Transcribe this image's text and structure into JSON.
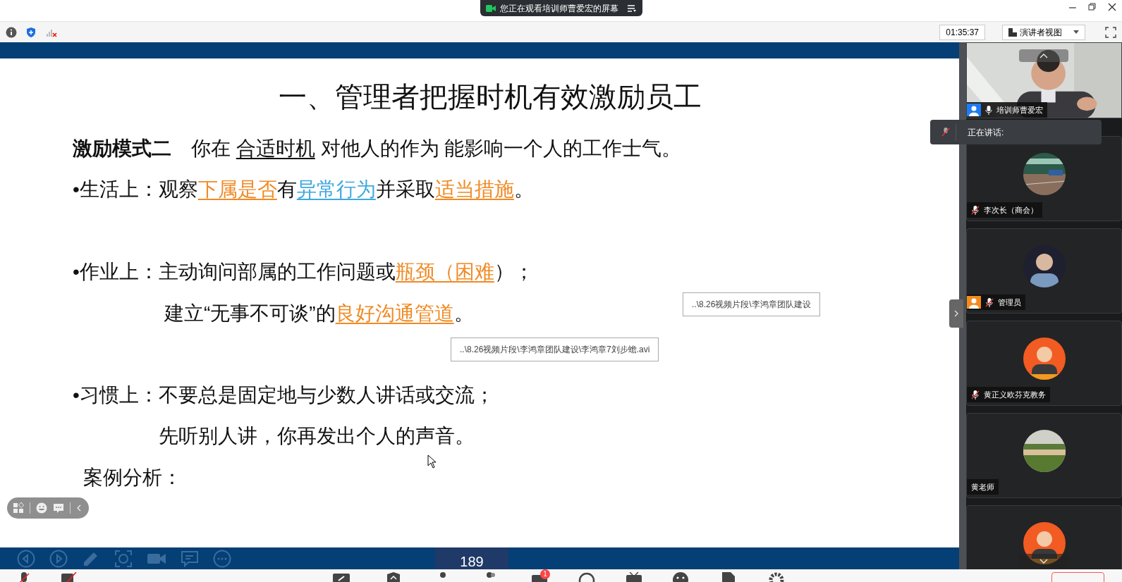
{
  "banner": {
    "text": "您正在观看培训师曹爱宏的屏幕"
  },
  "toolbar": {
    "time": "01:35:37",
    "view_button": "演讲者视图"
  },
  "slide": {
    "title": "一、管理者把握时机有效激励员工",
    "lines": [
      {
        "segments": [
          {
            "kind": "bold",
            "text": "激励模式二"
          },
          {
            "kind": "plain",
            "text": "　你在 "
          },
          {
            "kind": "underline",
            "text": "合适时机"
          },
          {
            "kind": "plain",
            "text": " 对他人的作为 能影响一个人的工作士气。"
          }
        ]
      },
      {
        "segments": [
          {
            "kind": "plain",
            "text": "•生活上：观察"
          },
          {
            "kind": "orange",
            "text": "下属是否"
          },
          {
            "kind": "plain",
            "text": "有"
          },
          {
            "kind": "blue",
            "text": "异常行为"
          },
          {
            "kind": "plain",
            "text": "并采取"
          },
          {
            "kind": "orange",
            "text": "适当措施"
          },
          {
            "kind": "plain",
            "text": "。"
          }
        ]
      },
      {
        "segments": [
          {
            "kind": "plain",
            "text": "•作业上：主动询问部属的工作问题或"
          },
          {
            "kind": "orange",
            "text": "瓶颈（困难"
          },
          {
            "kind": "plain",
            "text": "）；"
          }
        ]
      },
      {
        "segments": [
          {
            "kind": "plain",
            "text": "建立“无事不可谈”的"
          },
          {
            "kind": "orange",
            "text": "良好沟通管道"
          },
          {
            "kind": "plain",
            "text": "。"
          }
        ]
      },
      {
        "segments": [
          {
            "kind": "plain",
            "text": "•习惯上：不要总是固定地与少数人讲话或交流；"
          }
        ]
      },
      {
        "segments": [
          {
            "kind": "plain",
            "text": "先听别人讲，你再发出个人的声音。"
          }
        ]
      },
      {
        "segments": [
          {
            "kind": "plain",
            "text": "案例分析："
          }
        ]
      }
    ],
    "links": [
      "..\\8.26视频片段\\李鸿章团队建设",
      "..\\8.26视频片段\\李鸿章团队建设\\李鸿章7刘步蟾.avi"
    ],
    "page": "189"
  },
  "speaking": {
    "label": "正在讲话:"
  },
  "participants": [
    {
      "name": "培训师曹爱宏",
      "kind": "video",
      "muted": false,
      "color": "#1e7cf2"
    },
    {
      "name": "李次长（商会）",
      "kind": "picture",
      "muted": true
    },
    {
      "name": "管理员",
      "kind": "picture",
      "muted": true,
      "color": "#f28c1e"
    },
    {
      "name": "黄正义欧芬克教务",
      "kind": "picture",
      "muted": true
    },
    {
      "name": "黄老师",
      "kind": "picture"
    },
    {
      "kind": "picture"
    }
  ],
  "bottom_bar": {
    "chat_badge": "1"
  }
}
